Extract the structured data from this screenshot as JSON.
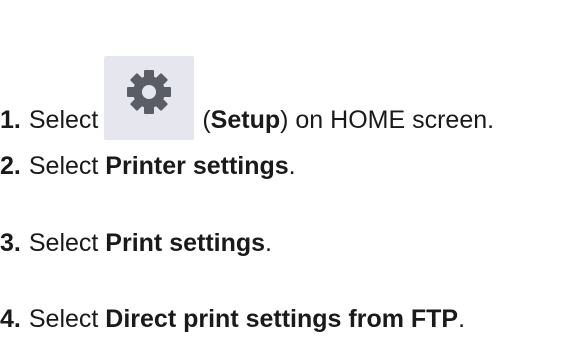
{
  "steps": [
    {
      "number": "1.",
      "prefix": "Select ",
      "icon": "setup-gear-icon",
      "paren_open": "(",
      "bold": "Setup",
      "paren_close": ")",
      "suffix": " on HOME screen."
    },
    {
      "number": "2.",
      "prefix": "Select ",
      "bold": "Printer settings",
      "suffix": "."
    },
    {
      "number": "3.",
      "prefix": "Select ",
      "bold": "Print settings",
      "suffix": "."
    },
    {
      "number": "4.",
      "prefix": "Select ",
      "bold": "Direct print settings from FTP",
      "suffix": "."
    }
  ],
  "colors": {
    "icon_background": "#e6e6ef",
    "icon_gear": "#5a5d66",
    "text": "#1a1a1a"
  }
}
